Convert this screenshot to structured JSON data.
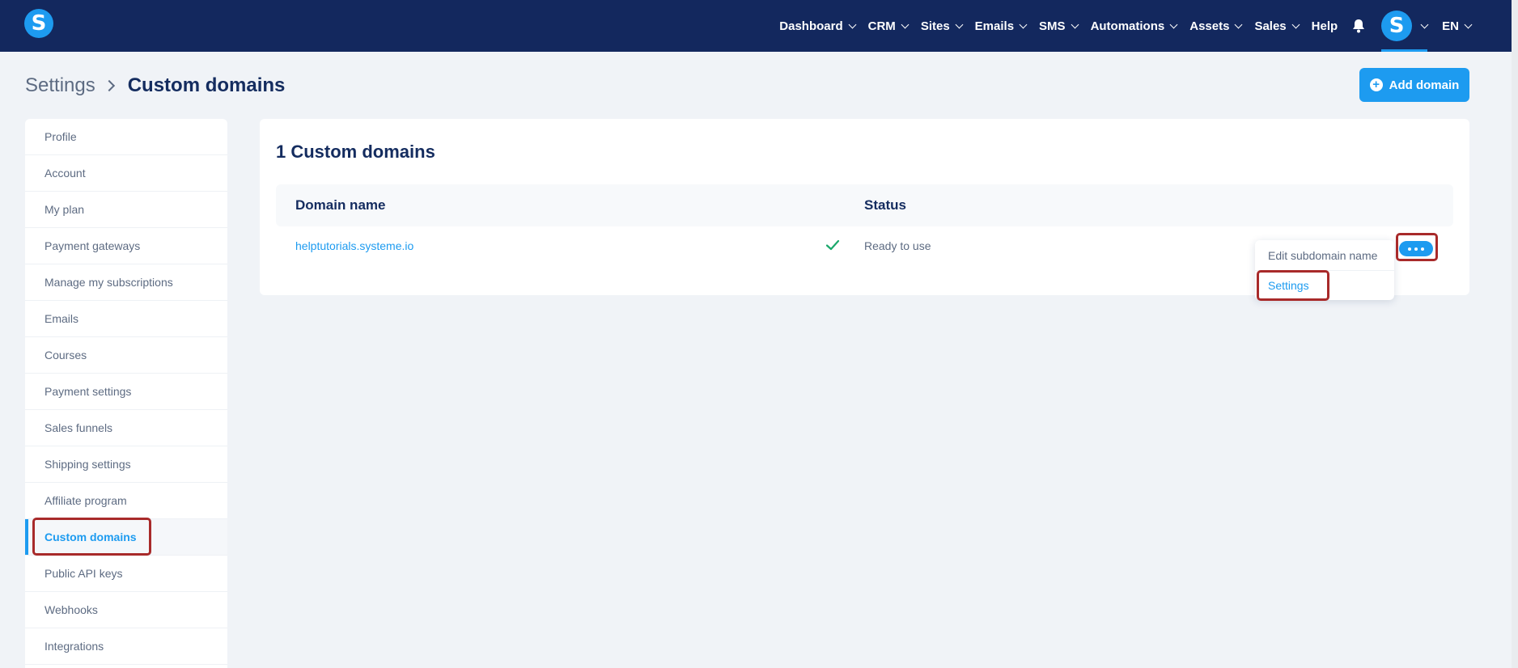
{
  "topbar": {
    "logo_letter": "S",
    "nav": [
      {
        "label": "Dashboard",
        "has_chevron": true
      },
      {
        "label": "CRM",
        "has_chevron": true
      },
      {
        "label": "Sites",
        "has_chevron": true
      },
      {
        "label": "Emails",
        "has_chevron": true
      },
      {
        "label": "SMS",
        "has_chevron": true
      },
      {
        "label": "Automations",
        "has_chevron": true
      },
      {
        "label": "Assets",
        "has_chevron": true
      },
      {
        "label": "Sales",
        "has_chevron": true
      },
      {
        "label": "Help",
        "has_chevron": false
      }
    ],
    "bell_icon": "bell-icon",
    "avatar_letter": "S",
    "language": "EN"
  },
  "breadcrumb": {
    "parent": "Settings",
    "current": "Custom domains"
  },
  "add_button": {
    "label": "Add domain",
    "icon": "plus-circle-icon"
  },
  "sidebar": {
    "items": [
      {
        "label": "Profile"
      },
      {
        "label": "Account"
      },
      {
        "label": "My plan"
      },
      {
        "label": "Payment gateways"
      },
      {
        "label": "Manage my subscriptions"
      },
      {
        "label": "Emails"
      },
      {
        "label": "Courses"
      },
      {
        "label": "Payment settings"
      },
      {
        "label": "Sales funnels"
      },
      {
        "label": "Shipping settings"
      },
      {
        "label": "Affiliate program"
      },
      {
        "label": "Custom domains"
      },
      {
        "label": "Public API keys"
      },
      {
        "label": "Webhooks"
      },
      {
        "label": "Integrations"
      }
    ],
    "active_index": 11
  },
  "main": {
    "title": "1 Custom domains",
    "columns": [
      "Domain name",
      "Status"
    ],
    "rows": [
      {
        "domain": "helptutorials.systeme.io",
        "status_icon": "check-icon",
        "status": "Ready to use"
      }
    ],
    "actions_icon": "more-dots-icon",
    "menu": {
      "items": [
        "Edit subdomain name",
        "Settings"
      ]
    }
  },
  "colors": {
    "nav_bg": "#13285e",
    "accent": "#1d9bf0",
    "highlight_box": "#a82a2a",
    "success": "#1aa86b"
  }
}
